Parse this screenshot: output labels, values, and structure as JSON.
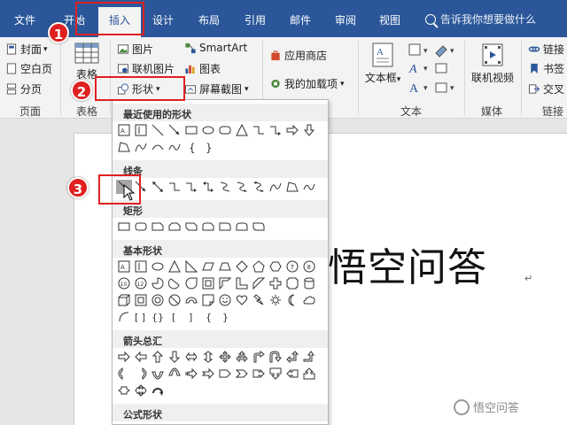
{
  "tabs": [
    "文件",
    "开始",
    "插入",
    "设计",
    "布局",
    "引用",
    "邮件",
    "审阅",
    "视图"
  ],
  "tell_me": "告诉我你想要做什么",
  "ribbon": {
    "pages": {
      "cover": "封面",
      "blank": "空白页",
      "break": "分页",
      "group": "页面"
    },
    "table": {
      "label": "表格"
    },
    "illustrations": {
      "picture": "图片",
      "online_picture": "联机图片",
      "shapes": "形状",
      "smartart": "SmartArt",
      "chart": "图表",
      "screenshot": "屏幕截图"
    },
    "addins": {
      "store": "应用商店",
      "my_addins": "我的加载项"
    },
    "text": {
      "textbox": "文本框",
      "group": "文本"
    },
    "media": {
      "online_video": "联机视频",
      "group": "媒体"
    },
    "links": {
      "link": "链接",
      "bookmark": "书签",
      "cross_ref": "交叉",
      "group": "链接"
    }
  },
  "shapes_menu": {
    "recent": "最近使用的形状",
    "lines": "线条",
    "rectangles": "矩形",
    "basic": "基本形状",
    "arrows": "箭头总汇",
    "equation": "公式形状"
  },
  "document": {
    "title": "悟空问答",
    "para_mark": "↵"
  },
  "annotations": [
    "1",
    "2",
    "3"
  ],
  "watermark": "悟空问答",
  "colors": {
    "accent": "#2b579a",
    "callout": "#e02020",
    "hover": "#a6a6a6"
  }
}
